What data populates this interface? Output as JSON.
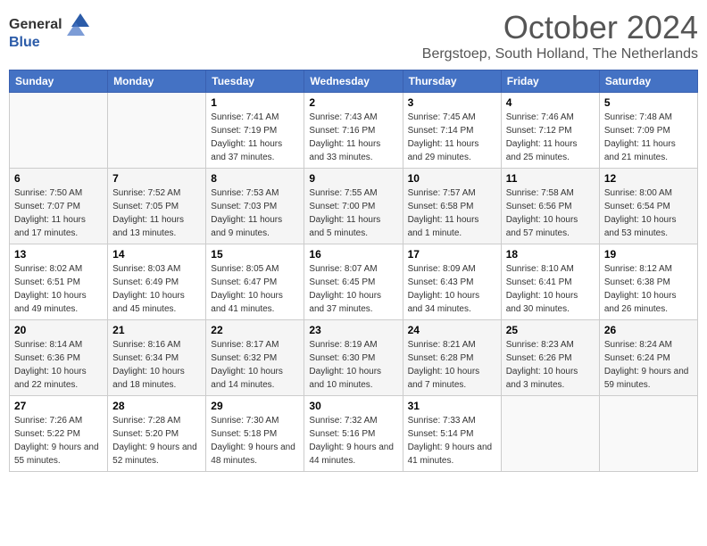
{
  "header": {
    "logo_general": "General",
    "logo_blue": "Blue",
    "month_year": "October 2024",
    "location": "Bergstoep, South Holland, The Netherlands"
  },
  "days_of_week": [
    "Sunday",
    "Monday",
    "Tuesday",
    "Wednesday",
    "Thursday",
    "Friday",
    "Saturday"
  ],
  "weeks": [
    [
      {
        "day": "",
        "sunrise": "",
        "sunset": "",
        "daylight": ""
      },
      {
        "day": "",
        "sunrise": "",
        "sunset": "",
        "daylight": ""
      },
      {
        "day": "1",
        "sunrise": "Sunrise: 7:41 AM",
        "sunset": "Sunset: 7:19 PM",
        "daylight": "Daylight: 11 hours and 37 minutes."
      },
      {
        "day": "2",
        "sunrise": "Sunrise: 7:43 AM",
        "sunset": "Sunset: 7:16 PM",
        "daylight": "Daylight: 11 hours and 33 minutes."
      },
      {
        "day": "3",
        "sunrise": "Sunrise: 7:45 AM",
        "sunset": "Sunset: 7:14 PM",
        "daylight": "Daylight: 11 hours and 29 minutes."
      },
      {
        "day": "4",
        "sunrise": "Sunrise: 7:46 AM",
        "sunset": "Sunset: 7:12 PM",
        "daylight": "Daylight: 11 hours and 25 minutes."
      },
      {
        "day": "5",
        "sunrise": "Sunrise: 7:48 AM",
        "sunset": "Sunset: 7:09 PM",
        "daylight": "Daylight: 11 hours and 21 minutes."
      }
    ],
    [
      {
        "day": "6",
        "sunrise": "Sunrise: 7:50 AM",
        "sunset": "Sunset: 7:07 PM",
        "daylight": "Daylight: 11 hours and 17 minutes."
      },
      {
        "day": "7",
        "sunrise": "Sunrise: 7:52 AM",
        "sunset": "Sunset: 7:05 PM",
        "daylight": "Daylight: 11 hours and 13 minutes."
      },
      {
        "day": "8",
        "sunrise": "Sunrise: 7:53 AM",
        "sunset": "Sunset: 7:03 PM",
        "daylight": "Daylight: 11 hours and 9 minutes."
      },
      {
        "day": "9",
        "sunrise": "Sunrise: 7:55 AM",
        "sunset": "Sunset: 7:00 PM",
        "daylight": "Daylight: 11 hours and 5 minutes."
      },
      {
        "day": "10",
        "sunrise": "Sunrise: 7:57 AM",
        "sunset": "Sunset: 6:58 PM",
        "daylight": "Daylight: 11 hours and 1 minute."
      },
      {
        "day": "11",
        "sunrise": "Sunrise: 7:58 AM",
        "sunset": "Sunset: 6:56 PM",
        "daylight": "Daylight: 10 hours and 57 minutes."
      },
      {
        "day": "12",
        "sunrise": "Sunrise: 8:00 AM",
        "sunset": "Sunset: 6:54 PM",
        "daylight": "Daylight: 10 hours and 53 minutes."
      }
    ],
    [
      {
        "day": "13",
        "sunrise": "Sunrise: 8:02 AM",
        "sunset": "Sunset: 6:51 PM",
        "daylight": "Daylight: 10 hours and 49 minutes."
      },
      {
        "day": "14",
        "sunrise": "Sunrise: 8:03 AM",
        "sunset": "Sunset: 6:49 PM",
        "daylight": "Daylight: 10 hours and 45 minutes."
      },
      {
        "day": "15",
        "sunrise": "Sunrise: 8:05 AM",
        "sunset": "Sunset: 6:47 PM",
        "daylight": "Daylight: 10 hours and 41 minutes."
      },
      {
        "day": "16",
        "sunrise": "Sunrise: 8:07 AM",
        "sunset": "Sunset: 6:45 PM",
        "daylight": "Daylight: 10 hours and 37 minutes."
      },
      {
        "day": "17",
        "sunrise": "Sunrise: 8:09 AM",
        "sunset": "Sunset: 6:43 PM",
        "daylight": "Daylight: 10 hours and 34 minutes."
      },
      {
        "day": "18",
        "sunrise": "Sunrise: 8:10 AM",
        "sunset": "Sunset: 6:41 PM",
        "daylight": "Daylight: 10 hours and 30 minutes."
      },
      {
        "day": "19",
        "sunrise": "Sunrise: 8:12 AM",
        "sunset": "Sunset: 6:38 PM",
        "daylight": "Daylight: 10 hours and 26 minutes."
      }
    ],
    [
      {
        "day": "20",
        "sunrise": "Sunrise: 8:14 AM",
        "sunset": "Sunset: 6:36 PM",
        "daylight": "Daylight: 10 hours and 22 minutes."
      },
      {
        "day": "21",
        "sunrise": "Sunrise: 8:16 AM",
        "sunset": "Sunset: 6:34 PM",
        "daylight": "Daylight: 10 hours and 18 minutes."
      },
      {
        "day": "22",
        "sunrise": "Sunrise: 8:17 AM",
        "sunset": "Sunset: 6:32 PM",
        "daylight": "Daylight: 10 hours and 14 minutes."
      },
      {
        "day": "23",
        "sunrise": "Sunrise: 8:19 AM",
        "sunset": "Sunset: 6:30 PM",
        "daylight": "Daylight: 10 hours and 10 minutes."
      },
      {
        "day": "24",
        "sunrise": "Sunrise: 8:21 AM",
        "sunset": "Sunset: 6:28 PM",
        "daylight": "Daylight: 10 hours and 7 minutes."
      },
      {
        "day": "25",
        "sunrise": "Sunrise: 8:23 AM",
        "sunset": "Sunset: 6:26 PM",
        "daylight": "Daylight: 10 hours and 3 minutes."
      },
      {
        "day": "26",
        "sunrise": "Sunrise: 8:24 AM",
        "sunset": "Sunset: 6:24 PM",
        "daylight": "Daylight: 9 hours and 59 minutes."
      }
    ],
    [
      {
        "day": "27",
        "sunrise": "Sunrise: 7:26 AM",
        "sunset": "Sunset: 5:22 PM",
        "daylight": "Daylight: 9 hours and 55 minutes."
      },
      {
        "day": "28",
        "sunrise": "Sunrise: 7:28 AM",
        "sunset": "Sunset: 5:20 PM",
        "daylight": "Daylight: 9 hours and 52 minutes."
      },
      {
        "day": "29",
        "sunrise": "Sunrise: 7:30 AM",
        "sunset": "Sunset: 5:18 PM",
        "daylight": "Daylight: 9 hours and 48 minutes."
      },
      {
        "day": "30",
        "sunrise": "Sunrise: 7:32 AM",
        "sunset": "Sunset: 5:16 PM",
        "daylight": "Daylight: 9 hours and 44 minutes."
      },
      {
        "day": "31",
        "sunrise": "Sunrise: 7:33 AM",
        "sunset": "Sunset: 5:14 PM",
        "daylight": "Daylight: 9 hours and 41 minutes."
      },
      {
        "day": "",
        "sunrise": "",
        "sunset": "",
        "daylight": ""
      },
      {
        "day": "",
        "sunrise": "",
        "sunset": "",
        "daylight": ""
      }
    ]
  ]
}
